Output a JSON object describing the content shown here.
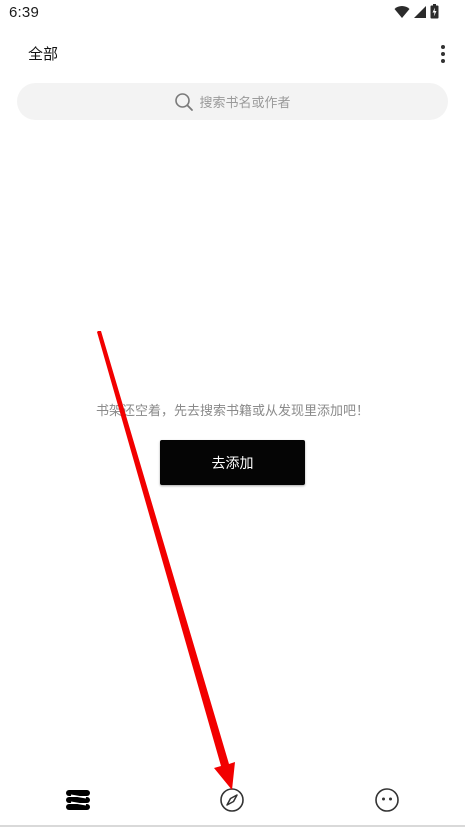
{
  "status_bar": {
    "time": "6:39",
    "icons": [
      "wifi-icon",
      "cellular-signal-icon",
      "battery-icon"
    ]
  },
  "header": {
    "title": "全部",
    "more_icon": "more-vertical-icon"
  },
  "search": {
    "placeholder": "搜索书名或作者",
    "icon": "search-icon"
  },
  "empty_state": {
    "message": "书架还空着，先去搜索书籍或从发现里添加吧！",
    "button_label": "去添加"
  },
  "bottom_nav": {
    "items": [
      {
        "name": "bookshelf",
        "icon": "bookshelf-icon"
      },
      {
        "name": "discover",
        "icon": "compass-icon"
      },
      {
        "name": "mine",
        "icon": "face-icon"
      }
    ]
  },
  "annotation": {
    "type": "red-arrow",
    "color": "#ff0000",
    "points_to": "compass-icon"
  }
}
